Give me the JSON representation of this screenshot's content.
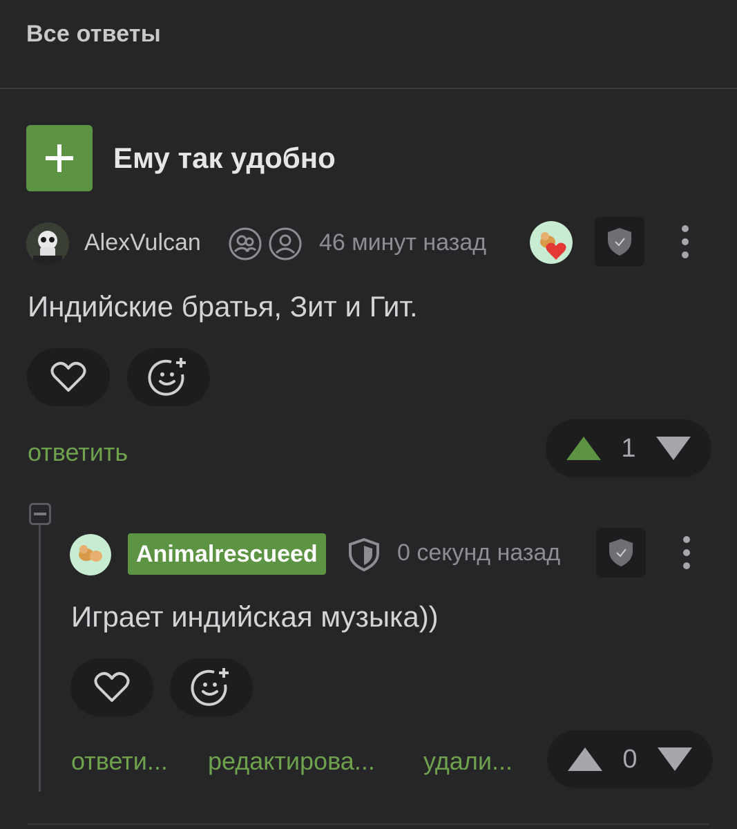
{
  "header": {
    "title": "Все ответы"
  },
  "thread": {
    "title": "Ему так удобно",
    "toggle_icon": "plus-icon",
    "accent": "#5d9443"
  },
  "comments": [
    {
      "username": "AlexVulcan",
      "time": "46 минут назад",
      "text": "Индийские братья, Зит и Гит.",
      "actions": [
        "ответить"
      ],
      "votes": "1"
    },
    {
      "username": "Animalrescueed",
      "time": "0 секунд назад",
      "text": "Играет индийская музыка))",
      "actions": [
        "ответи...",
        "редактирова...",
        "удали..."
      ],
      "votes": "0"
    }
  ],
  "colors": {
    "background": "#262628",
    "link": "#6ea24d",
    "upvote_active": "#5d9443",
    "control": "#1d1d1f"
  }
}
